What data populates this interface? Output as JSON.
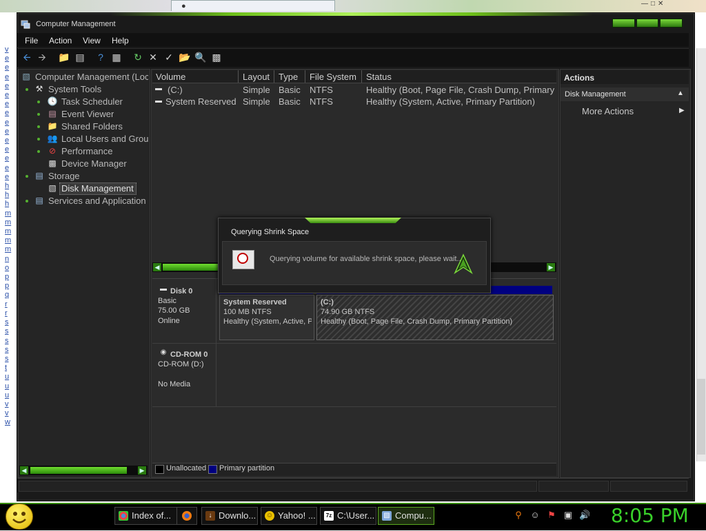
{
  "window": {
    "title": "Computer Management"
  },
  "menu": [
    "File",
    "Action",
    "View",
    "Help"
  ],
  "tree": {
    "root": "Computer Management (Loc",
    "items": [
      {
        "label": "System Tools"
      },
      {
        "label": "Task Scheduler"
      },
      {
        "label": "Event Viewer"
      },
      {
        "label": "Shared Folders"
      },
      {
        "label": "Local Users and Grou"
      },
      {
        "label": "Performance"
      },
      {
        "label": "Device Manager"
      },
      {
        "label": "Storage"
      },
      {
        "label": "Disk Management"
      },
      {
        "label": "Services and Application"
      }
    ]
  },
  "volumes": {
    "columns": [
      "Volume",
      "Layout",
      "Type",
      "File System",
      "Status"
    ],
    "rows": [
      {
        "volume": "(C:)",
        "layout": "Simple",
        "type": "Basic",
        "fs": "NTFS",
        "status": "Healthy (Boot, Page File, Crash Dump, Primary"
      },
      {
        "volume": "System Reserved",
        "layout": "Simple",
        "type": "Basic",
        "fs": "NTFS",
        "status": "Healthy (System, Active, Primary Partition)"
      }
    ]
  },
  "disks": {
    "disk0": {
      "name": "Disk 0",
      "type": "Basic",
      "size": "75.00 GB",
      "state": "Online"
    },
    "partitions": [
      {
        "name": "System Reserved",
        "size": "100 MB NTFS",
        "status": "Healthy (System, Active, P"
      },
      {
        "name": "(C:)",
        "size": "74.90 GB NTFS",
        "status": "Healthy (Boot, Page File, Crash Dump, Primary Partition)"
      }
    ],
    "cdrom": {
      "name": "CD-ROM 0",
      "drive": "CD-ROM (D:)",
      "state": "No Media"
    }
  },
  "legend": {
    "unallocated": "Unallocated",
    "primary": "Primary partition"
  },
  "actions": {
    "header": "Actions",
    "section": "Disk Management",
    "more": "More Actions"
  },
  "dialog": {
    "title": "Querying Shrink Space",
    "message": "Querying volume for available shrink space, please wait..."
  },
  "taskbar": {
    "tasks": [
      "Index of...",
      "",
      "Downlo...",
      "Yahoo! ...",
      "C:\\User...",
      "Compu..."
    ],
    "clock": "8:05 PM"
  },
  "colors": {
    "accent": "#39d12a",
    "primary_partition": "#000080"
  }
}
